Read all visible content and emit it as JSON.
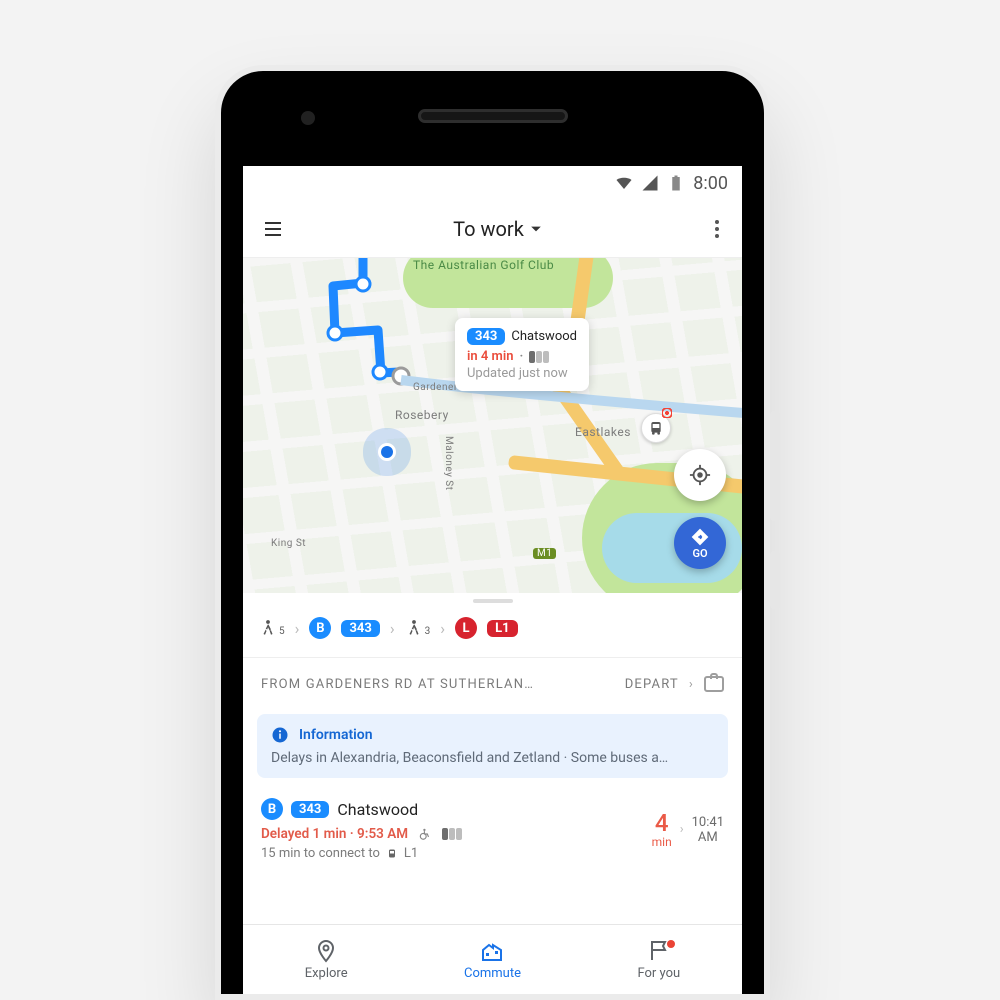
{
  "status": {
    "time": "8:00"
  },
  "header": {
    "title": "To work"
  },
  "map": {
    "labels": {
      "suburb1": "Rosebery",
      "suburb2": "Eastlakes",
      "poi1": "The Australian Golf Club",
      "street1": "Gardeners Rd",
      "street2": "Maloney St",
      "street3": "King St",
      "road_badge": "M1"
    },
    "tooltip": {
      "route": "343",
      "destination": "Chatswood",
      "eta": "in 4 min",
      "updated": "Updated just now"
    },
    "go_label": "GO"
  },
  "steps": {
    "walk1_min": "5",
    "bus_letter": "B",
    "bus_route": "343",
    "walk2_min": "3",
    "line_letter": "L",
    "line_pill": "L1"
  },
  "fromrow": {
    "from": "FROM GARDENERS RD AT SUTHERLAN…",
    "depart": "DEPART"
  },
  "info": {
    "title": "Information",
    "body": "Delays in Alexandria, Beaconsfield and Zetland · Some buses a…"
  },
  "entry": {
    "letter": "B",
    "route": "343",
    "dest": "Chatswood",
    "status": "Delayed 1 min · 9:53 AM",
    "connect": "15 min to connect to",
    "connect_line": "L1",
    "mins": "4",
    "mins_unit": "min",
    "arrive_time": "10:41",
    "arrive_unit": "AM"
  },
  "nav": {
    "explore": "Explore",
    "commute": "Commute",
    "foryou": "For you"
  },
  "colors": {
    "accent": "#1a73e8",
    "bus": "#1a8cff",
    "line": "#d7232e",
    "warn": "#ea5a47"
  }
}
